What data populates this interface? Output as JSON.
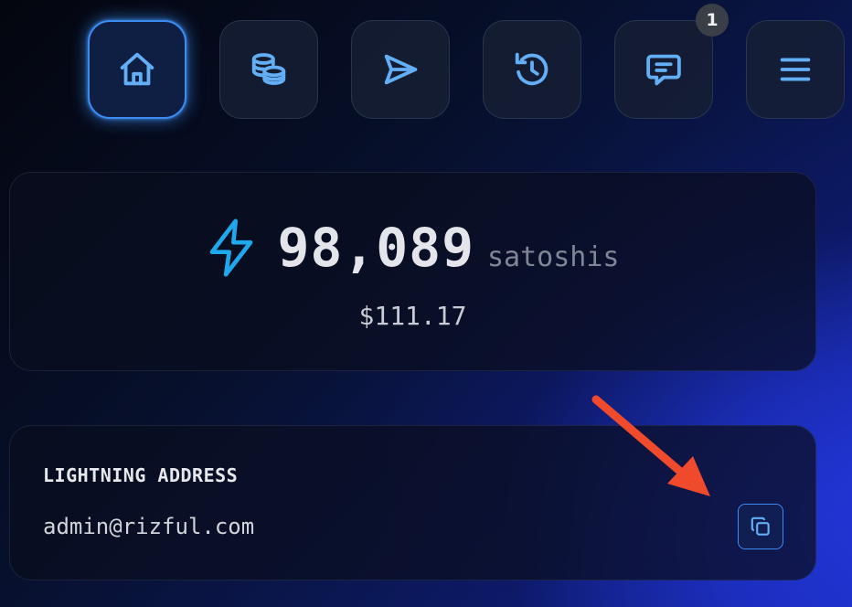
{
  "nav": {
    "items": [
      {
        "icon": "home-icon",
        "active": true
      },
      {
        "icon": "coins-icon",
        "active": false
      },
      {
        "icon": "send-icon",
        "active": false
      },
      {
        "icon": "history-icon",
        "active": false
      },
      {
        "icon": "chat-icon",
        "active": false,
        "badge": "1"
      },
      {
        "icon": "menu-icon",
        "active": false
      }
    ],
    "chat_badge": "1"
  },
  "balance": {
    "icon": "lightning-bolt-icon",
    "amount": "98,089",
    "unit": "satoshis",
    "fiat": "$111.17"
  },
  "lightning_address": {
    "label": "LIGHTNING ADDRESS",
    "value": "admin@rizful.com",
    "copy_icon": "copy-icon"
  },
  "colors": {
    "accent": "#63aef5",
    "accent_border": "#3c8bef",
    "annotation_arrow": "#f04a2c",
    "background_dark": "#05080f",
    "background_glow": "#1f35d6"
  }
}
